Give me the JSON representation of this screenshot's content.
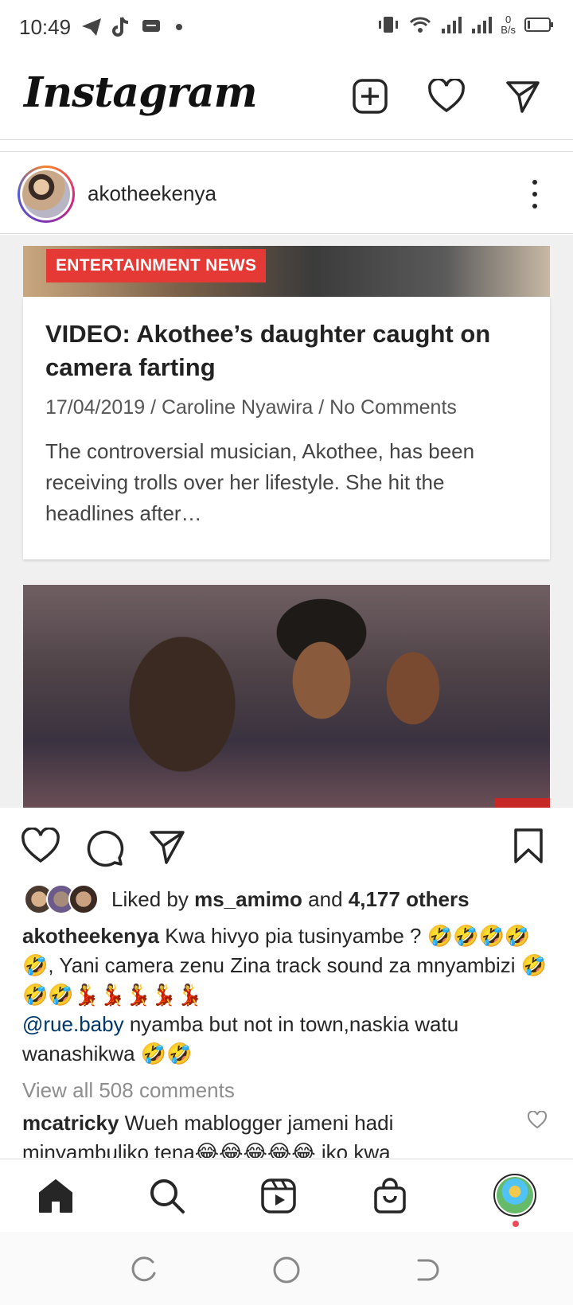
{
  "status_bar": {
    "time": "10:49",
    "net_speed_value": "0",
    "net_speed_unit": "B/s"
  },
  "header": {
    "logo": "Instagram"
  },
  "post": {
    "username": "akotheekenya",
    "article": {
      "badge": "ENTERTAINMENT NEWS",
      "title": "VIDEO: Akothee’s daughter caught on camera farting",
      "meta": "17/04/2019 / Caroline Nyawira / No Comments",
      "excerpt": "The controversial musician, Akothee, has been receiving trolls over her lifestyle. She hit the headlines after…"
    },
    "likes": {
      "prefix": "Liked by",
      "user": "ms_amimo",
      "middle": "and",
      "others": "4,177 others"
    },
    "caption": {
      "username": "akotheekenya",
      "text_1": "Kwa hivyo pia tusinyambe ? 🤣🤣🤣🤣🤣, Yani camera zenu Zina track sound za mnyambizi 🤣🤣🤣💃💃💃💃💃",
      "mention": "@rue.baby",
      "text_2": "nyamba but not in town,naskia watu wanashikwa 🤣🤣"
    },
    "view_comments": "View all 508 comments",
    "comment": {
      "username": "mcatricky",
      "text": "Wueh mablogger jameni hadi minyambuliko tena😂😂😂😂😂 iko kwa"
    }
  },
  "colors": {
    "badge_red": "#e53935",
    "mention_blue": "#00376b",
    "muted_gray": "#8e8e8e",
    "notif_red": "#ed4956"
  }
}
